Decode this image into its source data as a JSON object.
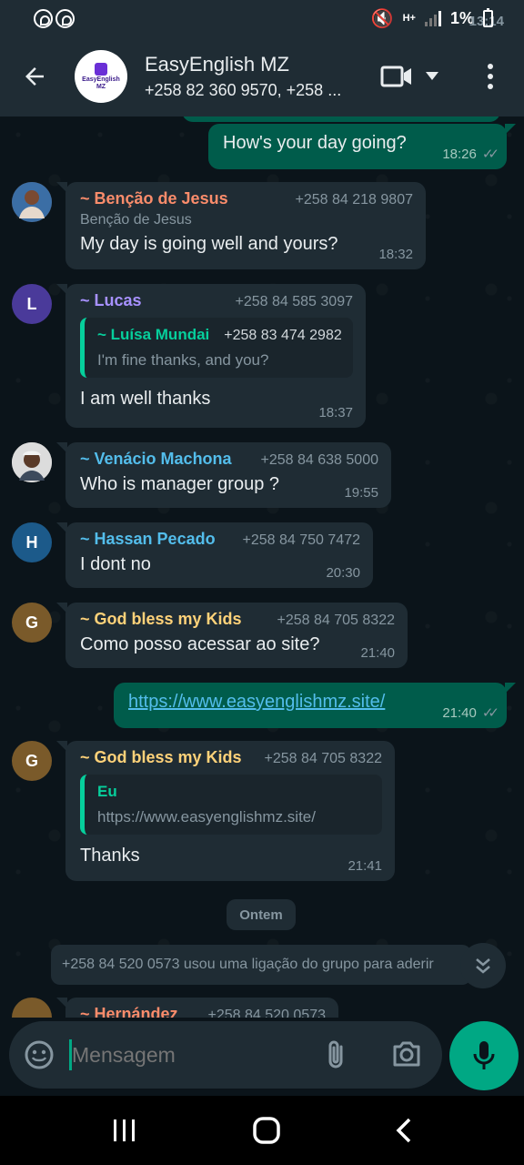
{
  "status_bar": {
    "time": "13:14",
    "battery": "1%",
    "network": "H+"
  },
  "header": {
    "title": "EasyEnglish MZ",
    "subtitle": "+258 82 360 9570, +258 ...",
    "logo_text_1": "EasyEnglish",
    "logo_text_2": "MZ"
  },
  "messages": [
    {
      "type": "out",
      "text": "How's your day going?",
      "time": "18:26"
    },
    {
      "type": "in",
      "sender": "~ Benção de Jesus",
      "phone": "+258 84 218 9807",
      "pushname": "Benção de Jesus",
      "text": "My day is going well and yours?",
      "time": "18:32",
      "color": "#fa8c6b"
    },
    {
      "type": "in",
      "sender": "~ Lucas",
      "avatar_letter": "L",
      "phone": "+258 84 585 3097",
      "quote_name": "~ Luísa Mundai",
      "quote_phone": "+258 83 474 2982",
      "quote_text": "I'm fine thanks, and you?",
      "text": "I am well thanks",
      "time": "18:37",
      "color": "#a791ff"
    },
    {
      "type": "in",
      "sender": "~ Venácio Machona",
      "phone": "+258 84 638 5000",
      "text": "Who is manager group ?",
      "time": "19:55",
      "color": "#53bdeb"
    },
    {
      "type": "in",
      "sender": "~ Hassan Pecado",
      "avatar_letter": "H",
      "phone": "+258 84 750 7472",
      "text": "I dont no",
      "time": "20:30",
      "color": "#53bdeb"
    },
    {
      "type": "in",
      "sender": "~ God bless my Kids",
      "avatar_letter": "G",
      "phone": "+258 84 705 8322",
      "text": "Como posso acessar ao site?",
      "time": "21:40",
      "color": "#ffd279"
    },
    {
      "type": "out",
      "link": "https://www.easyenglishmz.site/",
      "time": "21:40"
    },
    {
      "type": "in",
      "sender": "~ God bless my Kids",
      "avatar_letter": "G",
      "phone": "+258 84 705 8322",
      "quote_name": "Eu",
      "quote_text": "https://www.easyenglishmz.site/",
      "text": "Thanks",
      "time": "21:41",
      "color": "#ffd279"
    }
  ],
  "day_chip": "Ontem",
  "system_message": "+258 84 520 0573 usou uma ligação do grupo para aderir",
  "partial_message": {
    "sender": "~ Hernández",
    "phone": "+258 84 520 0573"
  },
  "input": {
    "placeholder": "Mensagem"
  },
  "colors": {
    "accent": "#00a884",
    "outgoing": "#005c4b",
    "incoming": "#1f2c34",
    "background": "#0b141a"
  }
}
